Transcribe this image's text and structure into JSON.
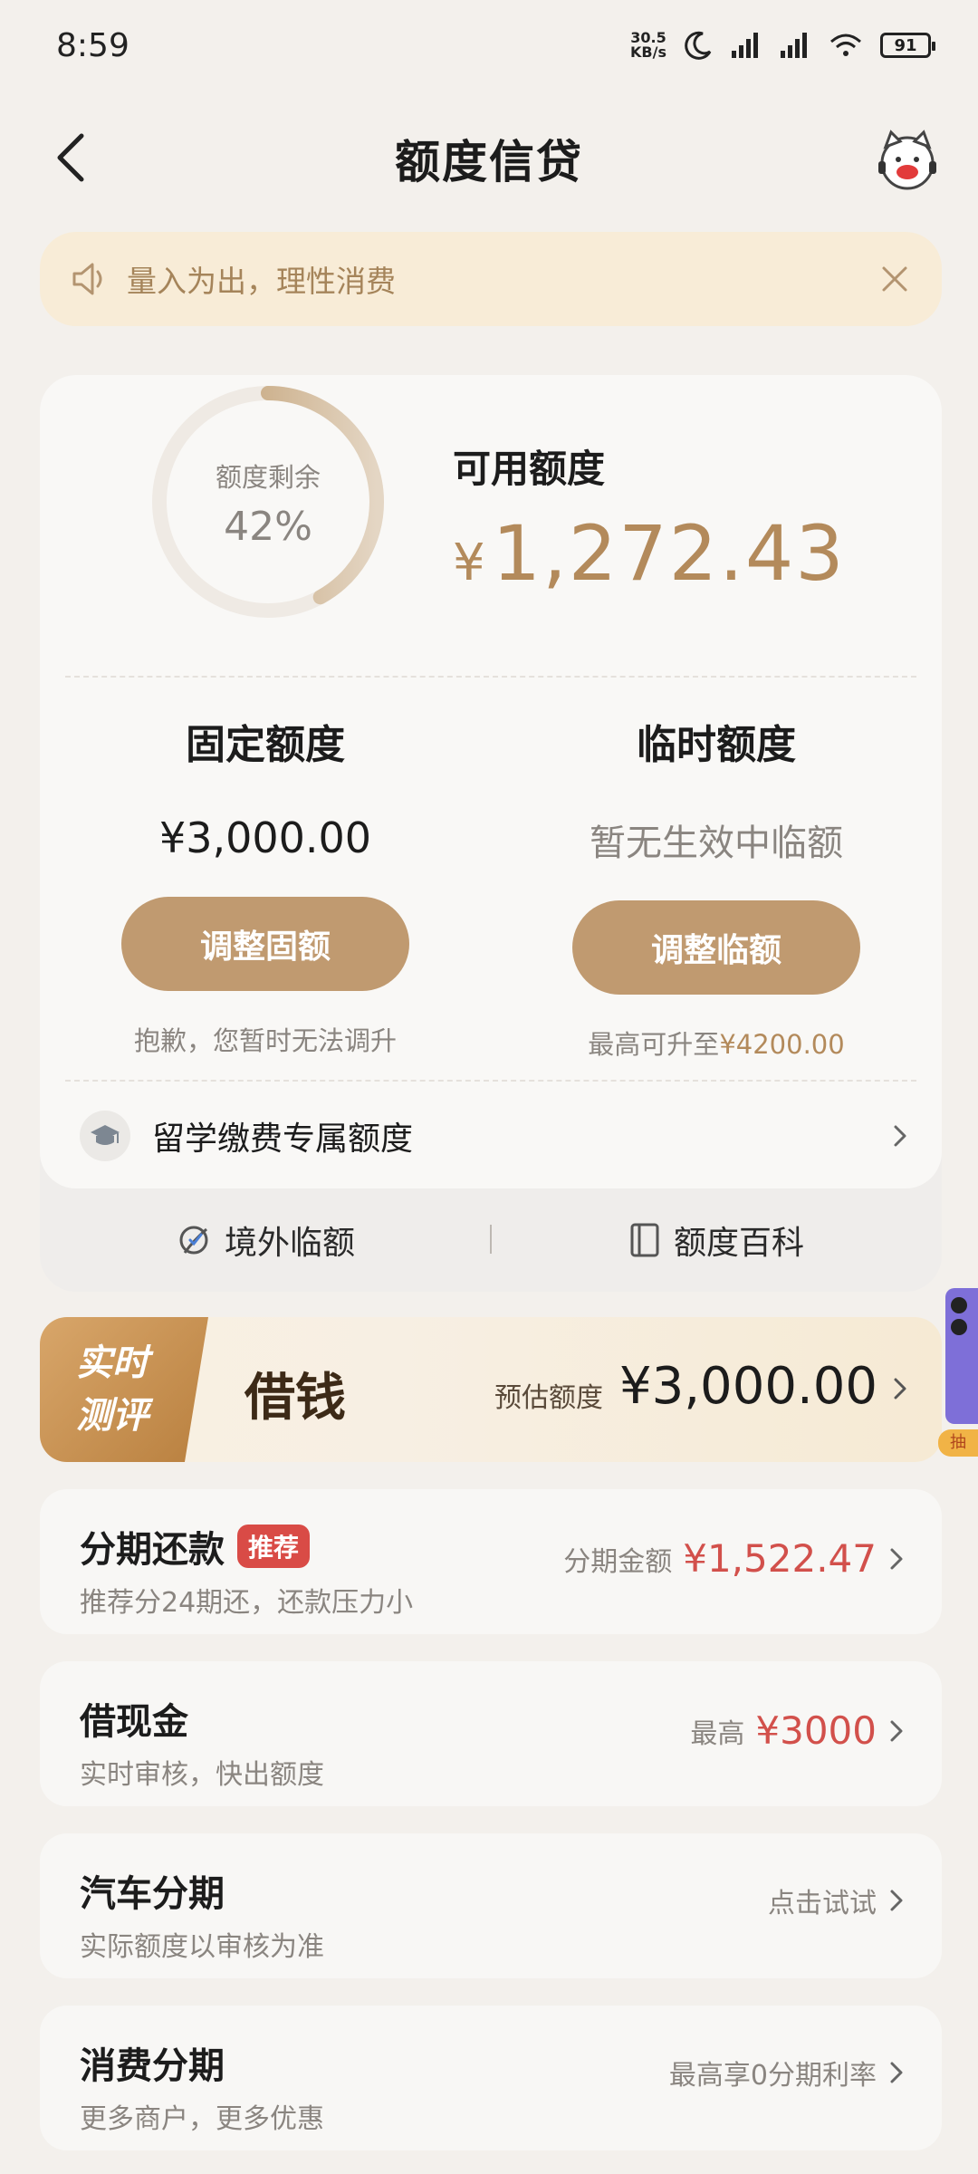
{
  "status_bar": {
    "time": "8:59",
    "net_speed_value": "30.5",
    "net_speed_unit": "KB/s",
    "battery": "91"
  },
  "header": {
    "title": "额度信贷"
  },
  "notice": {
    "text": "量入为出，理性消费"
  },
  "quota": {
    "ring_label": "额度剩余",
    "ring_percent": "42%",
    "ring_fraction": 0.42,
    "available_label": "可用额度",
    "available_currency": "¥",
    "available_value": "1,272.43",
    "fixed": {
      "title": "固定额度",
      "value": "¥3,000.00",
      "button": "调整固额",
      "note": "抱歉，您暂时无法调升"
    },
    "temp": {
      "title": "临时额度",
      "value": "暂无生效中临额",
      "button": "调整临额",
      "note_prefix": "最高可升至",
      "note_value": "¥4200.00"
    },
    "study_label": "留学缴费专属额度",
    "links": {
      "overseas": "境外临额",
      "encyclopedia": "额度百科"
    }
  },
  "loan_banner": {
    "tag_line1": "实时",
    "tag_line2": "测评",
    "title": "借钱",
    "est_label": "预估额度",
    "est_value": "¥3,000.00",
    "side_tag": "抽"
  },
  "list": [
    {
      "title": "分期还款",
      "badge": "推荐",
      "subtitle": "推荐分24期还，还款压力小",
      "right_label": "分期金额",
      "right_value": "¥1,522.47"
    },
    {
      "title": "借现金",
      "subtitle": "实时审核，快出额度",
      "right_label": "最高",
      "right_value": "¥3000"
    },
    {
      "title": "汽车分期",
      "subtitle": "实际额度以审核为准",
      "right_label": "点击试试",
      "right_value": ""
    },
    {
      "title": "消费分期",
      "subtitle": "更多商户，更多优惠",
      "right_label": "最高享0分期利率",
      "right_value": ""
    }
  ],
  "colors": {
    "gold": "#b38a5b",
    "button": "#c09a70",
    "accent_red": "#d2504b",
    "notice_bg": "#f8ecd7"
  }
}
